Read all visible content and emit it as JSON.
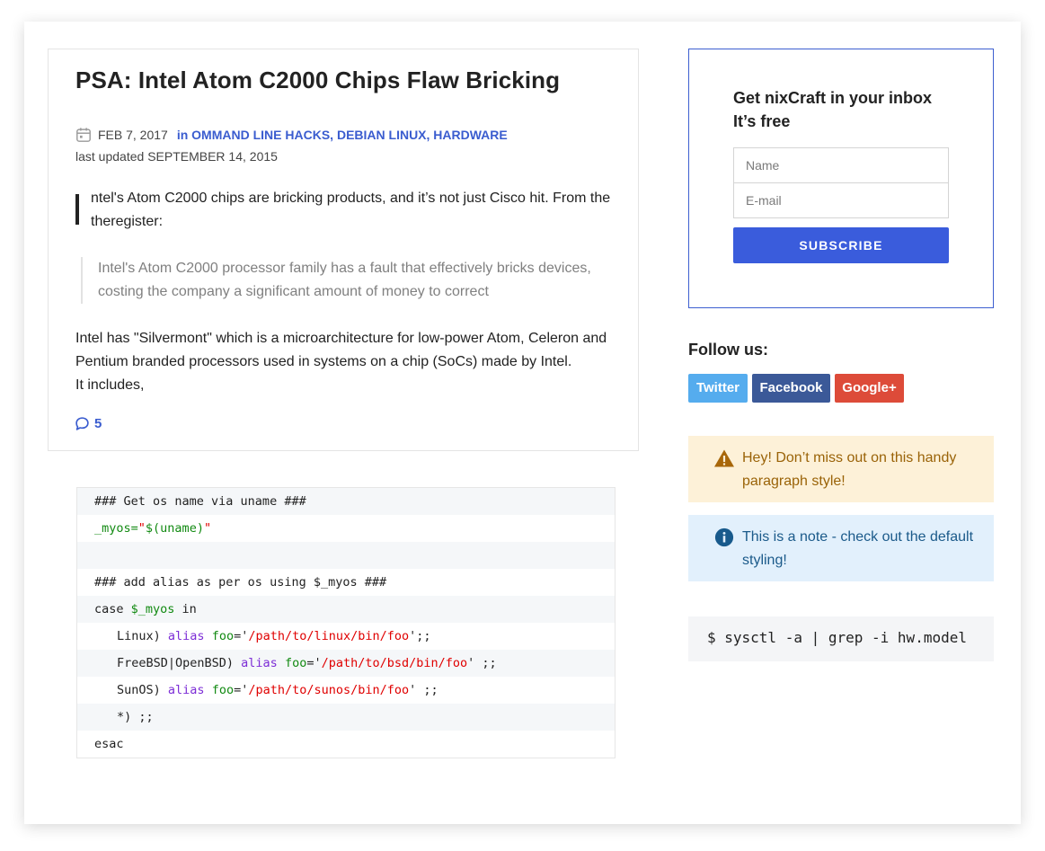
{
  "article": {
    "title": "PSA: Intel Atom C2000 Chips Flaw Bricking",
    "date": "FEB 7, 2017",
    "category_prefix": "in",
    "categories": [
      "OMMAND LINE HACKS",
      "DEBIAN LINUX",
      "HARDWARE"
    ],
    "category_separator": ", ",
    "updated_label": "last updated",
    "updated_date": "SEPTEMBER 14, 2015",
    "intro": "ntel's Atom C2000 chips are bricking products, and it’s not just Cisco hit. From the theregister:",
    "quote": "Intel's Atom C2000 processor family has a fault that effectively bricks devices, costing the company a significant amount of money to correct",
    "body_line1": "Intel has \"Silvermont\" which is a microarchitecture for low-power Atom, Celeron and Pentium branded processors used in systems on a chip (SoCs) made by Intel.",
    "body_line2": "It includes,",
    "comment_count": "5"
  },
  "code": {
    "lines": [
      [
        {
          "t": "### Get os name via uname ###",
          "c": ""
        }
      ],
      [
        {
          "t": "_myos=",
          "c": "green"
        },
        {
          "t": "\"",
          "c": "red"
        },
        {
          "t": "$(uname)",
          "c": "green"
        },
        {
          "t": "\"",
          "c": "red"
        }
      ],
      [
        {
          "t": "",
          "c": ""
        }
      ],
      [
        {
          "t": "### add alias as per os using $_myos ###",
          "c": ""
        }
      ],
      [
        {
          "t": "case ",
          "c": ""
        },
        {
          "t": "$_myos",
          "c": "green"
        },
        {
          "t": " in",
          "c": ""
        }
      ],
      [
        {
          "t": "Linux) ",
          "c": "",
          "indent": true
        },
        {
          "t": "alias ",
          "c": "purple"
        },
        {
          "t": "foo",
          "c": "green"
        },
        {
          "t": "='",
          "c": ""
        },
        {
          "t": "/path/to/linux/bin/foo",
          "c": "red"
        },
        {
          "t": "';;",
          "c": ""
        }
      ],
      [
        {
          "t": "FreeBSD|OpenBSD) ",
          "c": "",
          "indent": true
        },
        {
          "t": "alias ",
          "c": "purple"
        },
        {
          "t": "foo",
          "c": "green"
        },
        {
          "t": "='",
          "c": ""
        },
        {
          "t": "/path/to/bsd/bin/foo",
          "c": "red"
        },
        {
          "t": "' ;;",
          "c": ""
        }
      ],
      [
        {
          "t": "SunOS) ",
          "c": "",
          "indent": true
        },
        {
          "t": "alias ",
          "c": "purple"
        },
        {
          "t": "foo",
          "c": "green"
        },
        {
          "t": "='",
          "c": ""
        },
        {
          "t": "/path/to/sunos/bin/foo",
          "c": "red"
        },
        {
          "t": "' ;;",
          "c": ""
        }
      ],
      [
        {
          "t": "*) ;;",
          "c": "",
          "indent": true
        }
      ],
      [
        {
          "t": "esac",
          "c": ""
        }
      ]
    ]
  },
  "sidebar": {
    "subscribe_title_line1": "Get nixCraft in your inbox",
    "subscribe_title_line2": "It’s free",
    "name_placeholder": "Name",
    "email_placeholder": "E-mail",
    "subscribe_button": "SUBSCRIBE",
    "follow_title": "Follow us:",
    "social": [
      {
        "label": "Twitter",
        "color": "#55acee"
      },
      {
        "label": "Facebook",
        "color": "#3b5998"
      },
      {
        "label": "Google+",
        "color": "#dd4b39"
      }
    ],
    "warning_text": "Hey! Don’t miss out on this handy paragraph style!",
    "info_text": "This is a note - check out the default styling!",
    "command": "$ sysctl -a | grep -i hw.model"
  },
  "colors": {
    "accent": "#3a5ccf",
    "warning_bg": "#fdf1d8",
    "info_bg": "#e2f0fc"
  }
}
